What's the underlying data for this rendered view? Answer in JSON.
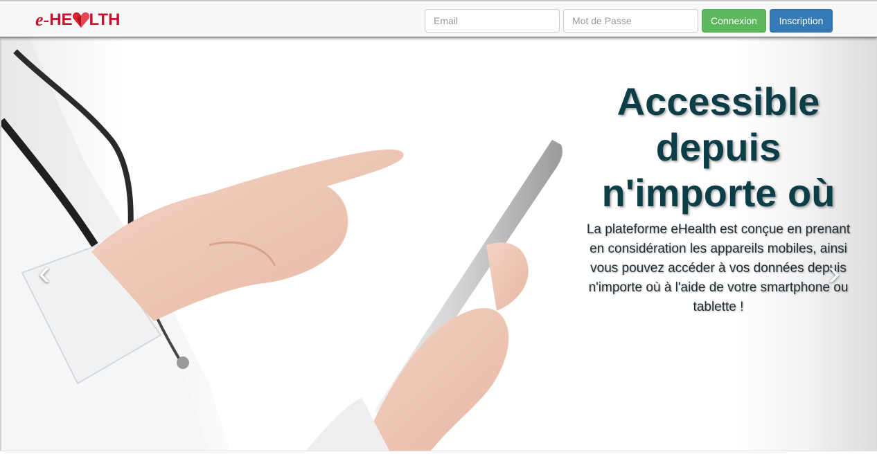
{
  "navbar": {
    "brand": {
      "prefix": "e-",
      "part1": "HE",
      "part2": "LTH",
      "icon": "heart-icon",
      "color": "#c4122f"
    },
    "email_placeholder": "Email",
    "password_placeholder": "Mot de Passe",
    "login_label": "Connexion",
    "signup_label": "Inscription"
  },
  "hero": {
    "headline": "Accessible depuis n'importe où",
    "description": "La plateforme eHealth est conçue en prenant en considération les appareils mobiles, ainsi vous pouvez accéder à vos données depuis n'importe où à l'aide de votre smartphone ou tablette !",
    "prev_icon": "chevron-left-icon",
    "next_icon": "chevron-right-icon",
    "prev_glyph": "‹",
    "next_glyph": "›"
  },
  "colors": {
    "headline": "#0d3d47",
    "login_button": "#5cb85c",
    "signup_button": "#337ab7"
  }
}
